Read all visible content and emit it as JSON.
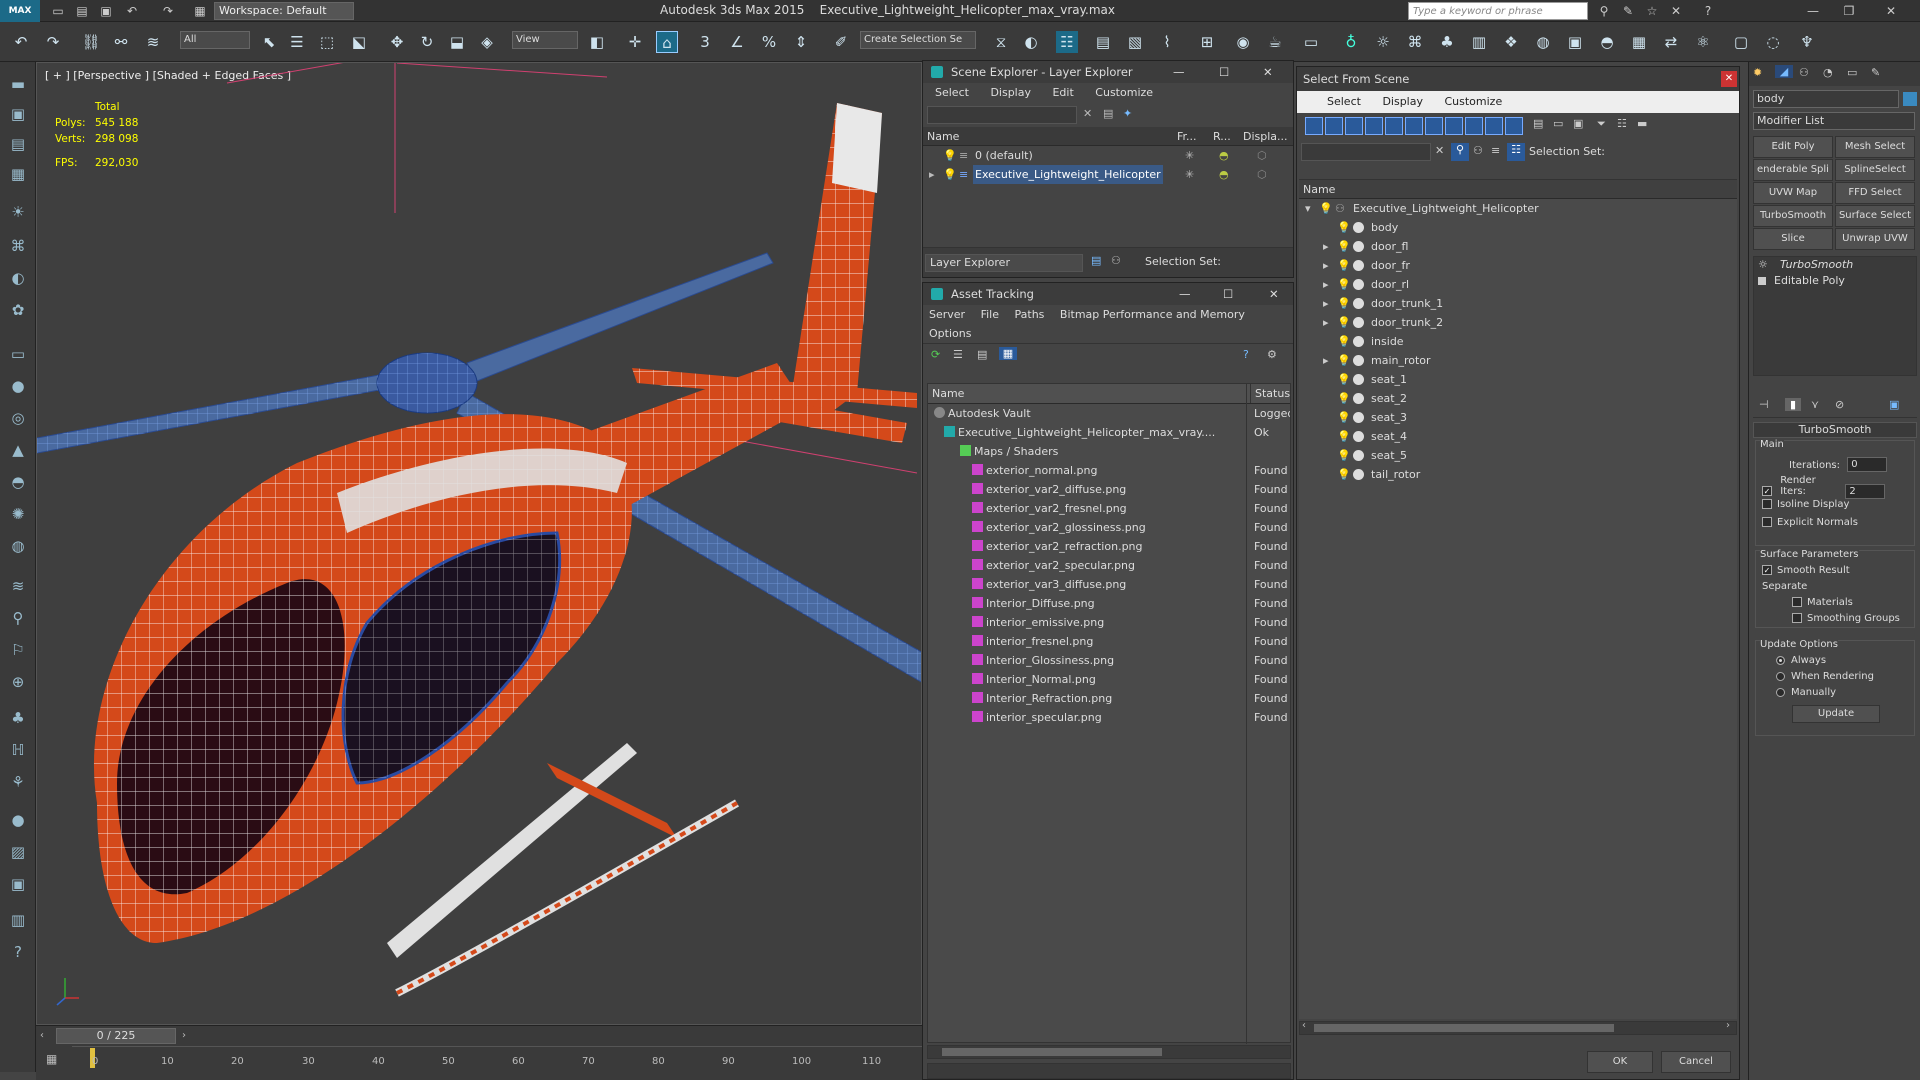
{
  "titlebar": {
    "logo": "MAX",
    "workspace": "Workspace: Default",
    "app": "Autodesk 3ds Max  2015",
    "file": "Executive_Lightweight_Helicopter_max_vray.max",
    "keyword_placeholder": "Type a keyword or phrase"
  },
  "toolbar": {
    "filter": "All",
    "refcoord": "View",
    "selset": "Create Selection Se"
  },
  "viewport": {
    "label": "[ + ] [Perspective ] [Shaded + Edged Faces ]",
    "stats": {
      "total": "Total",
      "polys_label": "Polys:",
      "polys": "545 188",
      "verts_label": "Verts:",
      "verts": "298 098",
      "fps_label": "FPS:",
      "fps": "292,030"
    }
  },
  "timeline": {
    "frame": "0 / 225",
    "ticks": [
      "0",
      "10",
      "20",
      "30",
      "40",
      "50",
      "60",
      "70",
      "80",
      "90",
      "100",
      "110"
    ]
  },
  "scene_explorer": {
    "title": "Scene Explorer - Layer Explorer",
    "menu": [
      "Select",
      "Display",
      "Edit",
      "Customize"
    ],
    "cols": [
      "Name",
      "Fr...",
      "R...",
      "Displa..."
    ],
    "rows": [
      "0 (default)",
      "Executive_Lightweight_Helicopter"
    ],
    "footer_combo": "Layer Explorer",
    "footer_selset": "Selection Set:"
  },
  "asset_tracking": {
    "title": "Asset Tracking",
    "menu": [
      "Server",
      "File",
      "Paths",
      "Bitmap Performance and Memory",
      "Options"
    ],
    "cols": [
      "Name",
      "Status"
    ],
    "rows": [
      {
        "name": "Autodesk Vault",
        "status": "Logged"
      },
      {
        "name": "Executive_Lightweight_Helicopter_max_vray....",
        "status": "Ok"
      },
      {
        "name": "Maps / Shaders",
        "status": ""
      },
      {
        "name": "exterior_normal.png",
        "status": "Found"
      },
      {
        "name": "exterior_var2_diffuse.png",
        "status": "Found"
      },
      {
        "name": "exterior_var2_fresnel.png",
        "status": "Found"
      },
      {
        "name": "exterior_var2_glossiness.png",
        "status": "Found"
      },
      {
        "name": "exterior_var2_refraction.png",
        "status": "Found"
      },
      {
        "name": "exterior_var2_specular.png",
        "status": "Found"
      },
      {
        "name": "exterior_var3_diffuse.png",
        "status": "Found"
      },
      {
        "name": "Interior_Diffuse.png",
        "status": "Found"
      },
      {
        "name": "interior_emissive.png",
        "status": "Found"
      },
      {
        "name": "interior_fresnel.png",
        "status": "Found"
      },
      {
        "name": "Interior_Glossiness.png",
        "status": "Found"
      },
      {
        "name": "Interior_Normal.png",
        "status": "Found"
      },
      {
        "name": "Interior_Refraction.png",
        "status": "Found"
      },
      {
        "name": "interior_specular.png",
        "status": "Found"
      }
    ]
  },
  "select_from_scene": {
    "title": "Select From Scene",
    "menu": [
      "Select",
      "Display",
      "Customize"
    ],
    "selset": "Selection Set:",
    "col": "Name",
    "root": "Executive_Lightweight_Helicopter",
    "items": [
      "body",
      "door_fl",
      "door_fr",
      "door_rl",
      "door_trunk_1",
      "door_trunk_2",
      "inside",
      "main_rotor",
      "seat_1",
      "seat_2",
      "seat_3",
      "seat_4",
      "seat_5",
      "tail_rotor"
    ],
    "ok": "OK",
    "cancel": "Cancel"
  },
  "command_panel": {
    "object_name": "body",
    "modifier_list": "Modifier List",
    "buttons": [
      "Edit Poly",
      "Mesh Select",
      "enderable Spli",
      "SplineSelect",
      "UVW Map",
      "FFD Select",
      "TurboSmooth",
      "Surface Select",
      "Slice",
      "Unwrap UVW"
    ],
    "stack": [
      "TurboSmooth",
      "Editable Poly"
    ],
    "rollout": "TurboSmooth",
    "main": "Main",
    "iterations_label": "Iterations:",
    "iterations": "0",
    "render_iters_label": "Render Iters:",
    "render_iters": "2",
    "isoline": "Isoline Display",
    "explicit": "Explicit Normals",
    "surface": "Surface Parameters",
    "smooth": "Smooth Result",
    "separate": "Separate",
    "materials": "Materials",
    "smoothing": "Smoothing Groups",
    "update_opts": "Update Options",
    "always": "Always",
    "when_rendering": "When Rendering",
    "manually": "Manually",
    "update": "Update"
  }
}
